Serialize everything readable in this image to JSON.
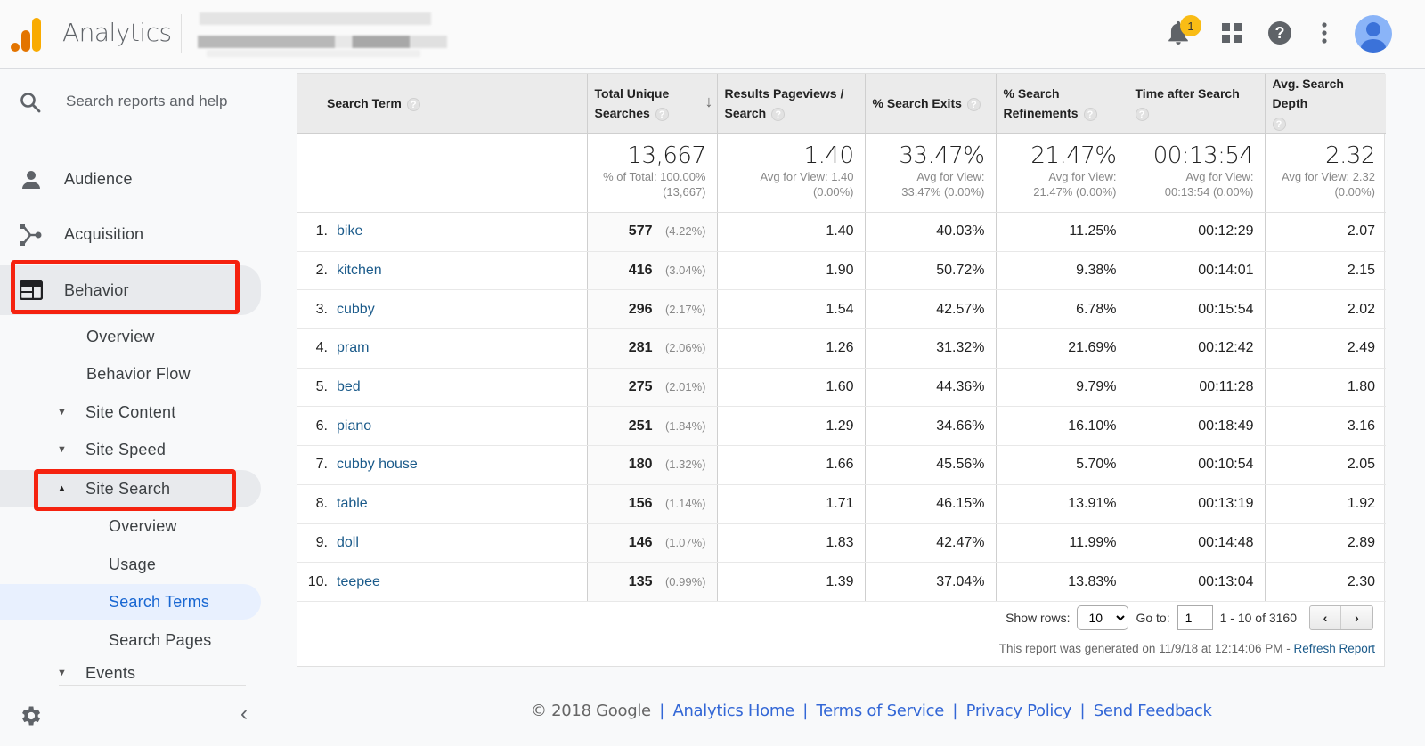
{
  "header": {
    "app_title": "Analytics",
    "notification_count": "1",
    "icons": [
      "analytics-logo-icon",
      "bell-icon",
      "apps-grid-icon",
      "help-icon",
      "more-vert-icon",
      "avatar-icon"
    ]
  },
  "sidebar": {
    "search_placeholder": "Search reports and help",
    "sections": [
      {
        "label": "Audience",
        "icon": "person-icon"
      },
      {
        "label": "Acquisition",
        "icon": "acquisition-icon"
      },
      {
        "label": "Behavior",
        "icon": "behavior-icon",
        "expanded": true
      }
    ],
    "behavior_items": {
      "overview": "Overview",
      "behavior_flow": "Behavior Flow",
      "site_content": "Site Content",
      "site_speed": "Site Speed",
      "site_search": "Site Search",
      "site_search_children": [
        "Overview",
        "Usage",
        "Search Terms",
        "Search Pages"
      ],
      "events": "Events"
    },
    "active_item": "Search Terms",
    "caret_collapsed": "▼",
    "caret_expanded": "▲",
    "collapse_glyph": "‹"
  },
  "table": {
    "headers": {
      "term": "Search Term",
      "unique_line1": "Total Unique",
      "unique_line2": "Searches",
      "pageviews_line1": "Results Pageviews /",
      "pageviews_line2": "Search",
      "exits": "% Search Exits",
      "refinements_line1": "% Search",
      "refinements_line2": "Refinements",
      "time": "Time after Search",
      "depth": "Avg. Search Depth",
      "help_glyph": "?",
      "sort_glyph": "↓"
    },
    "totals": {
      "unique": {
        "value": "13,667",
        "sub1": "% of Total: 100.00%",
        "sub2": "(13,667)"
      },
      "pageviews": {
        "value": "1.40",
        "sub1": "Avg for View: 1.40",
        "sub2": "(0.00%)"
      },
      "exits": {
        "value": "33.47%",
        "sub1": "Avg for View:",
        "sub2": "33.47% (0.00%)"
      },
      "refinements": {
        "value": "21.47%",
        "sub1": "Avg for View:",
        "sub2": "21.47% (0.00%)"
      },
      "time": {
        "value": "00:13:54",
        "sub1": "Avg for View:",
        "sub2": "00:13:54 (0.00%)"
      },
      "depth": {
        "value": "2.32",
        "sub1": "Avg for View: 2.32",
        "sub2": "(0.00%)"
      }
    },
    "rows": [
      {
        "rank": "1.",
        "term": "bike",
        "unique": "577",
        "pct": "(4.22%)",
        "pageviews": "1.40",
        "exits": "40.03%",
        "refinements": "11.25%",
        "time": "00:12:29",
        "depth": "2.07"
      },
      {
        "rank": "2.",
        "term": "kitchen",
        "unique": "416",
        "pct": "(3.04%)",
        "pageviews": "1.90",
        "exits": "50.72%",
        "refinements": "9.38%",
        "time": "00:14:01",
        "depth": "2.15"
      },
      {
        "rank": "3.",
        "term": "cubby",
        "unique": "296",
        "pct": "(2.17%)",
        "pageviews": "1.54",
        "exits": "42.57%",
        "refinements": "6.78%",
        "time": "00:15:54",
        "depth": "2.02"
      },
      {
        "rank": "4.",
        "term": "pram",
        "unique": "281",
        "pct": "(2.06%)",
        "pageviews": "1.26",
        "exits": "31.32%",
        "refinements": "21.69%",
        "time": "00:12:42",
        "depth": "2.49"
      },
      {
        "rank": "5.",
        "term": "bed",
        "unique": "275",
        "pct": "(2.01%)",
        "pageviews": "1.60",
        "exits": "44.36%",
        "refinements": "9.79%",
        "time": "00:11:28",
        "depth": "1.80"
      },
      {
        "rank": "6.",
        "term": "piano",
        "unique": "251",
        "pct": "(1.84%)",
        "pageviews": "1.29",
        "exits": "34.66%",
        "refinements": "16.10%",
        "time": "00:18:49",
        "depth": "3.16"
      },
      {
        "rank": "7.",
        "term": "cubby house",
        "unique": "180",
        "pct": "(1.32%)",
        "pageviews": "1.66",
        "exits": "45.56%",
        "refinements": "5.70%",
        "time": "00:10:54",
        "depth": "2.05"
      },
      {
        "rank": "8.",
        "term": "table",
        "unique": "156",
        "pct": "(1.14%)",
        "pageviews": "1.71",
        "exits": "46.15%",
        "refinements": "13.91%",
        "time": "00:13:19",
        "depth": "1.92"
      },
      {
        "rank": "9.",
        "term": "doll",
        "unique": "146",
        "pct": "(1.07%)",
        "pageviews": "1.83",
        "exits": "42.47%",
        "refinements": "11.99%",
        "time": "00:14:48",
        "depth": "2.89"
      },
      {
        "rank": "10.",
        "term": "teepee",
        "unique": "135",
        "pct": "(0.99%)",
        "pageviews": "1.39",
        "exits": "37.04%",
        "refinements": "13.83%",
        "time": "00:13:04",
        "depth": "2.30"
      }
    ]
  },
  "pagination": {
    "show_rows_label": "Show rows:",
    "show_rows_value": "10",
    "goto_label": "Go to:",
    "goto_value": "1",
    "range": "1 - 10 of 3160",
    "prev_glyph": "‹",
    "next_glyph": "›"
  },
  "report_note": {
    "text": "This report was generated on 11/9/18 at 12:14:06 PM - ",
    "refresh_link": "Refresh Report"
  },
  "footer": {
    "copyright": "© 2018 Google",
    "links": [
      "Analytics Home",
      "Terms of Service",
      "Privacy Policy",
      "Send Feedback"
    ],
    "separator": "|"
  },
  "colors": {
    "accent_orange": "#f9ab00",
    "accent_orange_dark": "#e37400",
    "highlight_red": "#f5220f",
    "link_blue": "#1a5a8a",
    "active_blue": "#1967d2",
    "badge_yellow": "#f9bc15"
  }
}
